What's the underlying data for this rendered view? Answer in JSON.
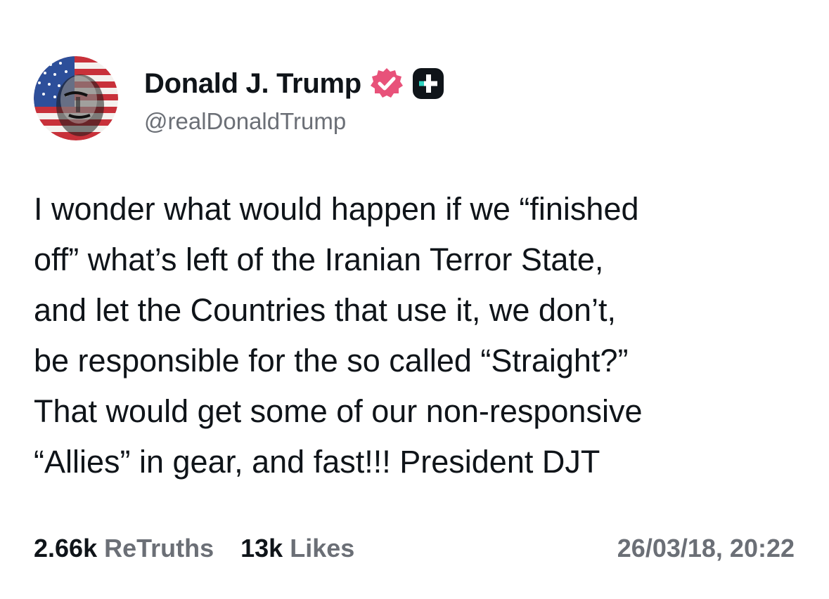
{
  "post": {
    "author": {
      "display_name": "Donald J. Trump",
      "handle": "@realDonaldTrump",
      "avatar_icon": "avatar-flag-portrait",
      "verified_icon": "verified-badge-icon",
      "verified_color": "#e8527a",
      "plus_icon": "plus-badge-icon"
    },
    "text_lines": [
      "I wonder what would happen if we “finished",
      "off” what’s left of the Iranian Terror State,",
      "and let the Countries that use it, we don’t,",
      "be responsible for the so called “Straight?”",
      "That would get some of our non-responsive",
      "“Allies” in gear, and fast!!! President DJT"
    ],
    "stats": {
      "retruths_count": "2.66k",
      "retruths_label": "ReTruths",
      "likes_count": "13k",
      "likes_label": "Likes"
    },
    "timestamp": "26/03/18, 20:22"
  },
  "colors": {
    "text": "#0f1419",
    "muted": "#6b6f76",
    "badge_pink": "#e8527a",
    "plus_teal": "#2fd4c0"
  }
}
